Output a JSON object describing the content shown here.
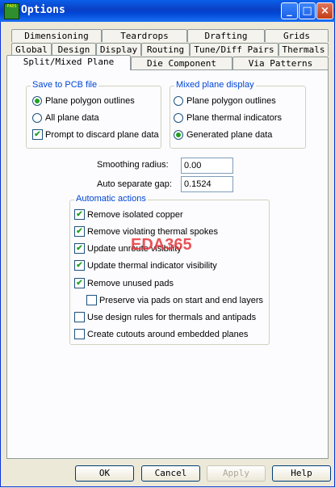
{
  "window": {
    "title": "Options",
    "icon_text": "PADS",
    "controls": {
      "minimize": "_",
      "maximize": "□",
      "close": "×"
    }
  },
  "tabs": {
    "row1": [
      "Dimensioning",
      "Teardrops",
      "Drafting",
      "Grids"
    ],
    "row2": [
      "Global",
      "Design",
      "Display",
      "Routing",
      "Tune/Diff Pairs",
      "Thermals"
    ],
    "row3": [
      "Split/Mixed Plane",
      "Die Component",
      "Via Patterns"
    ],
    "active": "Split/Mixed Plane"
  },
  "save_group": {
    "title": "Save to PCB file",
    "polygon_outlines": "Plane polygon outlines",
    "all_plane_data": "All plane data",
    "prompt_discard": "Prompt to discard plane data",
    "selected": "Plane polygon outlines",
    "prompt_checked": true
  },
  "mixed_group": {
    "title": "Mixed plane display",
    "polygon_outlines": "Plane polygon outlines",
    "thermal_indicators": "Plane thermal indicators",
    "generated_data": "Generated plane data",
    "selected": "Generated plane data"
  },
  "smoothing": {
    "label": "Smoothing radius:",
    "value": "0.00"
  },
  "separate_gap": {
    "label": "Auto separate gap:",
    "value": "0.1524"
  },
  "auto_actions": {
    "title": "Automatic actions",
    "items": [
      {
        "label": "Remove isolated copper",
        "checked": true
      },
      {
        "label": "Remove violating thermal spokes",
        "checked": true
      },
      {
        "label": "Update unroute visibility",
        "checked": true
      },
      {
        "label": "Update thermal indicator visibility",
        "checked": true
      },
      {
        "label": "Remove unused pads",
        "checked": true
      },
      {
        "label": "Preserve via pads on start and end layers",
        "checked": false
      },
      {
        "label": "Use design rules for thermals and antipads",
        "checked": false
      },
      {
        "label": "Create cutouts around embedded planes",
        "checked": false
      }
    ]
  },
  "watermark": "EDA365",
  "buttons": {
    "ok": "OK",
    "cancel": "Cancel",
    "apply": "Apply",
    "help": "Help"
  }
}
